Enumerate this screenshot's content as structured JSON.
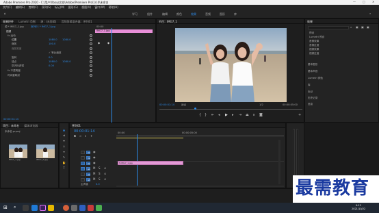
{
  "title_bar": {
    "title": "Adobe Premiere Pro 2020 - C:\\用户\\Xboy\\文档\\Adobe\\Premiere Pro\\14.0\\未命名",
    "minimize": "—",
    "maximize": "□",
    "close": "✕"
  },
  "menu": [
    "文件(F)",
    "编辑(E)",
    "剪辑(C)",
    "序列(S)",
    "标记(M)",
    "图形(G)",
    "视图(V)",
    "窗口(W)",
    "帮助(H)"
  ],
  "workspaces": [
    "学习",
    "组件",
    "编辑",
    "颜色",
    "效果",
    "音频",
    "图形",
    "库"
  ],
  "effect_controls": {
    "tabs": [
      "效果控件",
      "Lumetri 范围",
      "源：(无剪辑)",
      "音频剪辑混合器：序列01"
    ],
    "source": "源 * IMG7_1.jpg",
    "sequence": "序列01 * IMG7_1.jpg",
    "timecode_start": "00:00",
    "clip_chip": "IMG7_1.jpg",
    "section_video": "视频",
    "rows": [
      {
        "label": "fx 运动"
      },
      {
        "label": "位置",
        "value1": "1080.0",
        "value2": "1080.0"
      },
      {
        "label": "缩放",
        "value1": "100.0"
      },
      {
        "label": "缩放宽度"
      },
      {
        "label": "✓ 等比缩放"
      },
      {
        "label": "旋转",
        "value1": "0.0"
      },
      {
        "label": "锚点",
        "value1": "1080.0",
        "value2": "1080.0"
      },
      {
        "label": "防闪烁滤镜",
        "value1": "0.00"
      },
      {
        "label": "fx 不透明度"
      },
      {
        "label": "时间重映射"
      }
    ],
    "footer_timecode": "00:00:01:14"
  },
  "program_monitor": {
    "tab": "节目：IMG7_1",
    "timecode": "00:00:01:14",
    "fit": "适合",
    "quality": "1/2",
    "duration": "00:00:05:00"
  },
  "effects_panel": {
    "title": "效果",
    "items": [
      "预设",
      "Lumetri 预设",
      "音频效果",
      "音频过渡",
      "视频效果",
      "视频过渡"
    ],
    "sections": [
      "基本图形",
      "基本声音",
      "Lumetri 颜色",
      "库",
      "标记",
      "历史记录",
      "信息"
    ]
  },
  "project_panel": {
    "tabs": [
      "项目：未命名",
      "媒体浏览器"
    ],
    "file": "未命名.prproj",
    "thumbs": [
      "IMG7_1.jpg",
      "IMG7_2.jpg"
    ]
  },
  "timeline": {
    "tab": "序列01",
    "timecode": "00:00:01:14",
    "video_tracks": [
      "V3",
      "V2",
      "V1"
    ],
    "audio_tracks": [
      "A1",
      "A2",
      "A3"
    ],
    "master": "主声道",
    "master_value": "0.0",
    "clip": "IMG7_1.jpg",
    "ruler": [
      "00:00",
      "00:00:05:00"
    ]
  },
  "taskbar": {
    "time": "9:12",
    "date": "2021/10/22"
  },
  "watermark": "最需教育"
}
